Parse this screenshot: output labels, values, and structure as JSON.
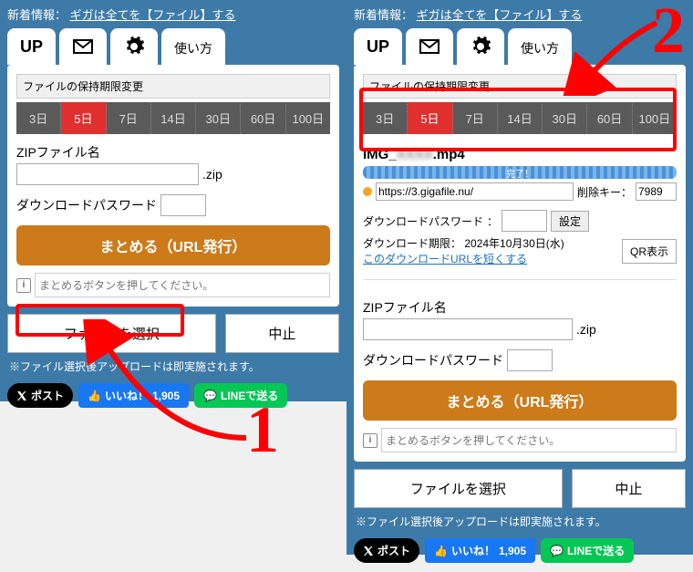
{
  "news": {
    "label": "新着情報：",
    "link": "ギガは全てを【ファイル】する"
  },
  "tabs": {
    "up": "UP",
    "usage": "使い方"
  },
  "retention": {
    "label": "ファイルの保持期限変更",
    "options": [
      "3日",
      "5日",
      "7日",
      "14日",
      "30日",
      "60日",
      "100日"
    ],
    "active_index": 1
  },
  "zip": {
    "label": "ZIPファイル名",
    "suffix": ".zip"
  },
  "pw": {
    "label": "ダウンロードパスワード",
    "colon": "："
  },
  "combine_btn": "まとめる（URL発行）",
  "info_hint": "まとめるボタンを押してください。",
  "actions": {
    "select": "ファイルを選択",
    "cancel": "中止"
  },
  "note": "※ファイル選択後アップロードは即実施されます。",
  "share": {
    "x": "ポスト",
    "fb": "いいね！",
    "fb_count": "1,905",
    "line": "LINEで送る"
  },
  "uploaded": {
    "filename_prefix": "IMG_",
    "filename_suffix": ".mp4",
    "progress_label": "完了！",
    "url_prefix": "https://3.gigafile.nu/",
    "del_label": "削除キー：",
    "del_value": "7989",
    "set_btn": "設定",
    "expire_label": "ダウンロード期限：",
    "expire_value": "2024年10月30日(水)",
    "shorten_link": "このダウンロードURLを短くする",
    "qr_btn": "QR表示"
  },
  "annotations": {
    "num1": "1",
    "num2": "2"
  }
}
